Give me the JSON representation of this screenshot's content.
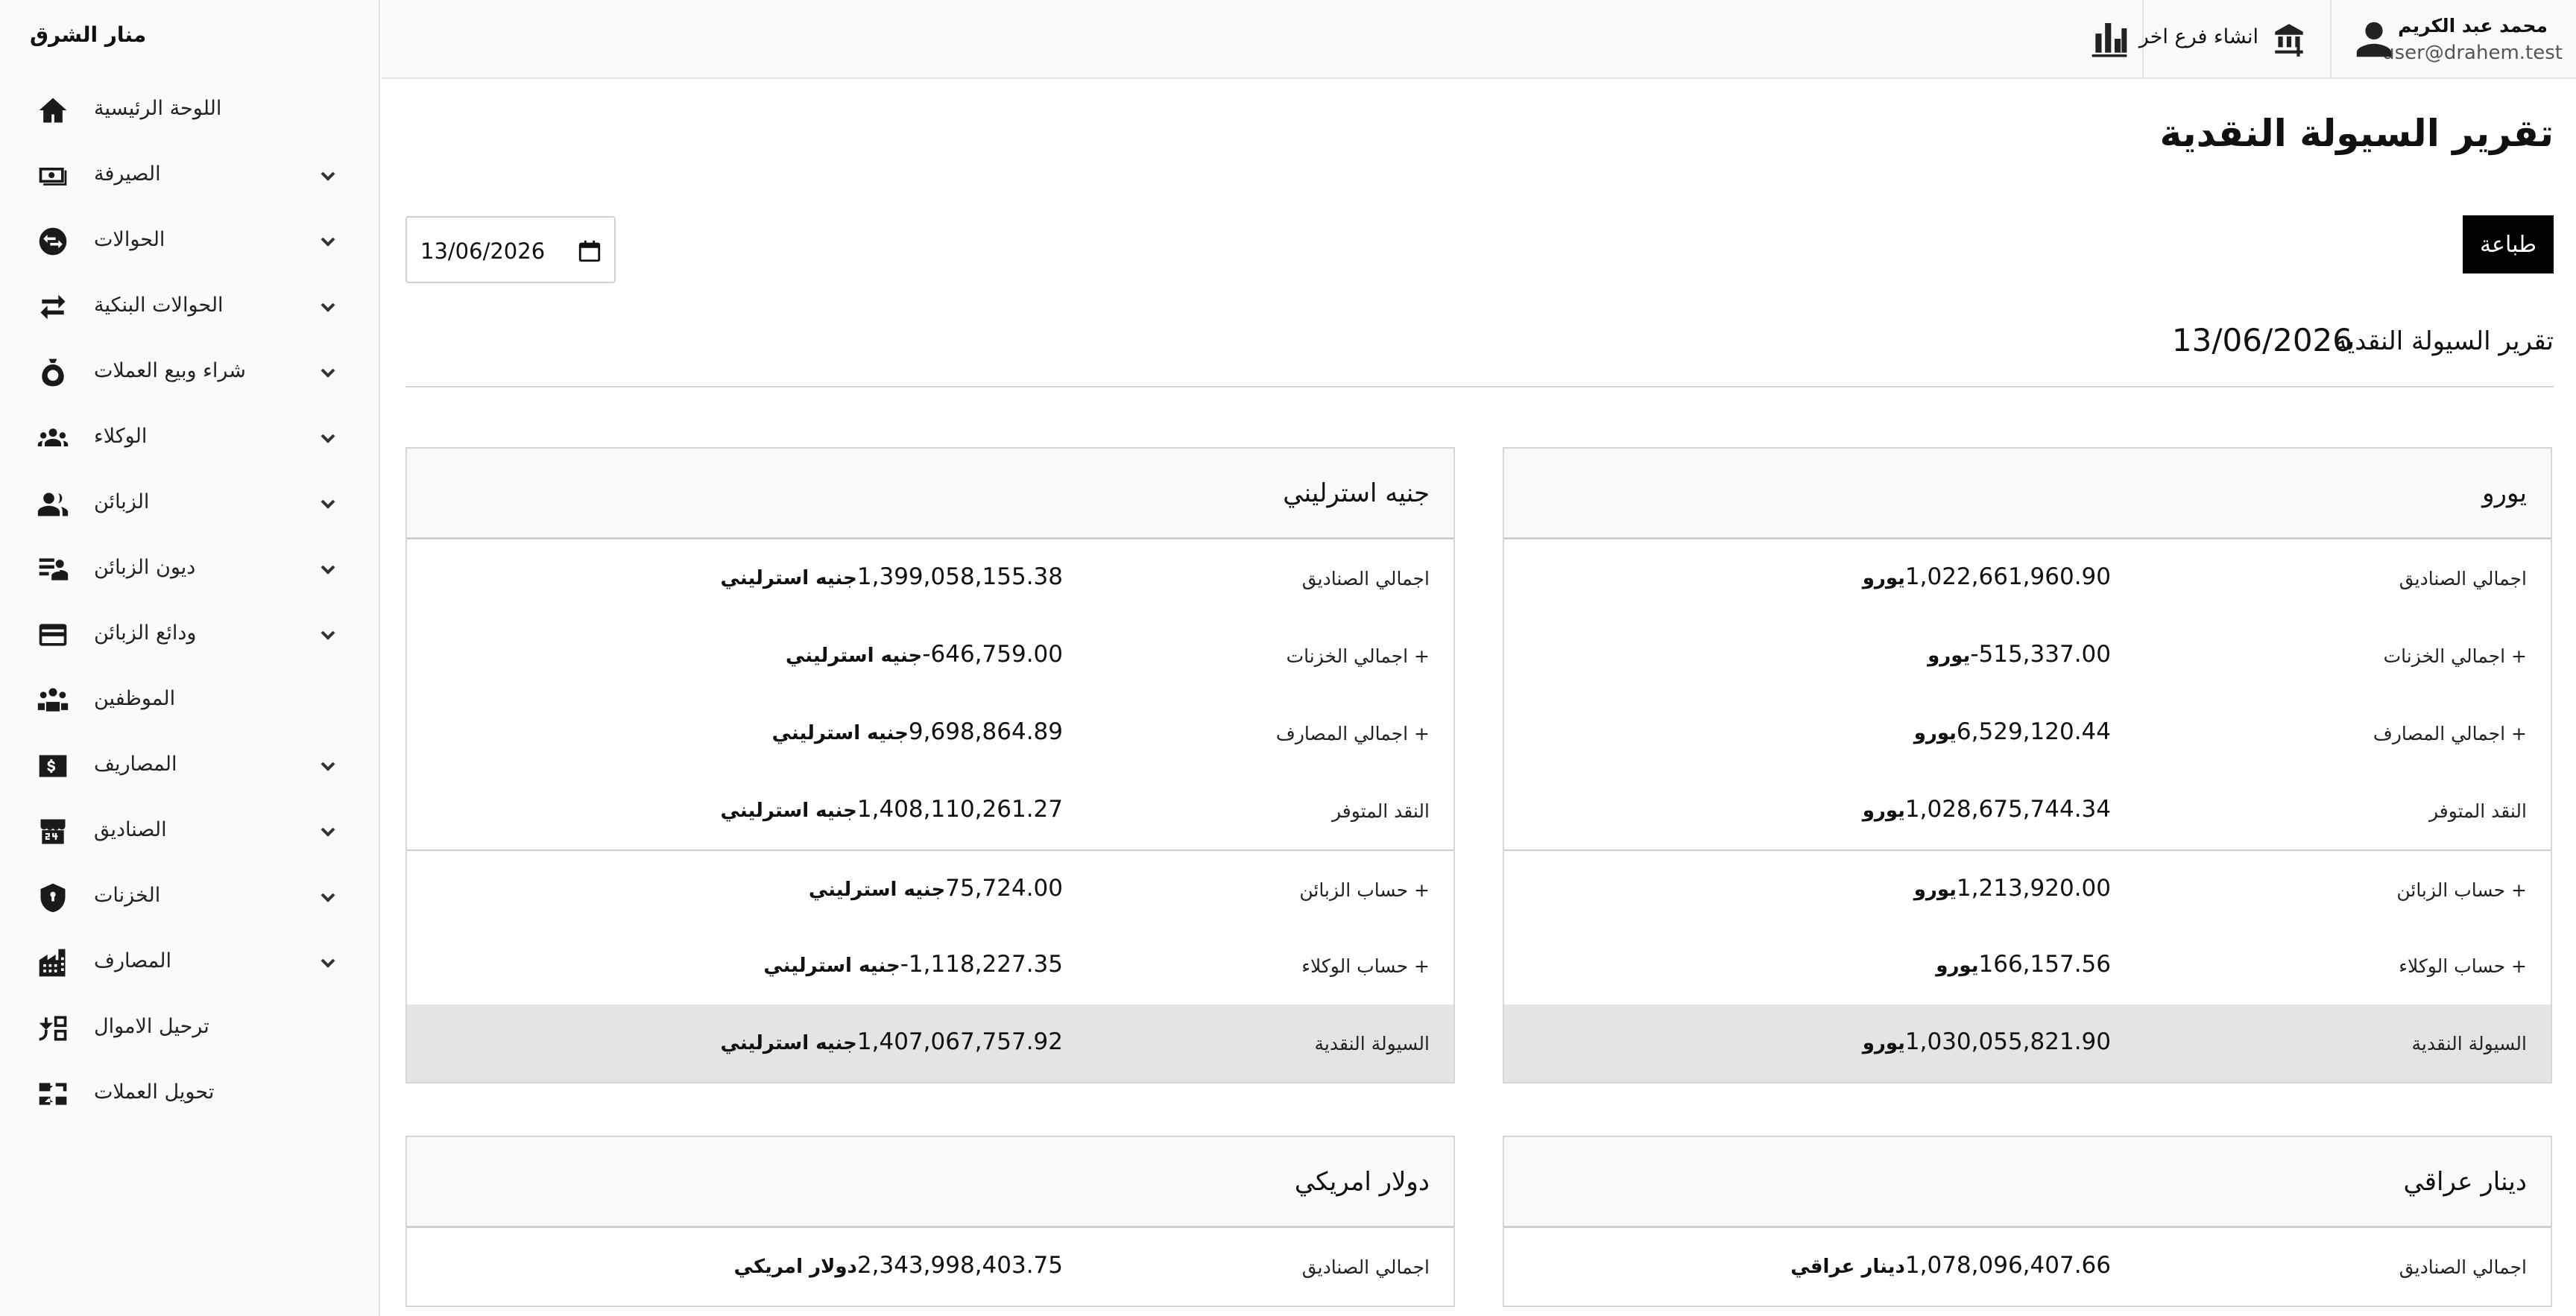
{
  "brand": "منار الشرق",
  "sidebar": {
    "items": [
      {
        "label": "اللوحة الرئيسية",
        "icon": "home-icon",
        "has_children": false
      },
      {
        "label": "الصيرفة",
        "icon": "cash-stack-icon",
        "has_children": true
      },
      {
        "label": "الحوالات",
        "icon": "currency-exchange-icon",
        "has_children": true
      },
      {
        "label": "الحوالات البنكية",
        "icon": "swap-arrows-icon",
        "has_children": true
      },
      {
        "label": "شراء وبيع العملات",
        "icon": "money-bag-icon",
        "has_children": true
      },
      {
        "label": "الوكلاء",
        "icon": "group-icon",
        "has_children": true
      },
      {
        "label": "الزبائن",
        "icon": "people-icon",
        "has_children": true
      },
      {
        "label": "ديون الزبائن",
        "icon": "person-list-icon",
        "has_children": true
      },
      {
        "label": "ودائع الزبائن",
        "icon": "wallet-icon",
        "has_children": true
      },
      {
        "label": "الموظفين",
        "icon": "team-icon",
        "has_children": false
      },
      {
        "label": "المصاريف",
        "icon": "dollar-note-icon",
        "has_children": true
      },
      {
        "label": "الصناديق",
        "icon": "store-24-icon",
        "has_children": true
      },
      {
        "label": "الخزنات",
        "icon": "shield-icon",
        "has_children": true
      },
      {
        "label": "المصارف",
        "icon": "bank-building-icon",
        "has_children": true
      },
      {
        "label": "ترحيل الاموال",
        "icon": "transfer-icon",
        "has_children": false
      },
      {
        "label": "تحويل العملات",
        "icon": "exchange-arrows-icon",
        "has_children": false
      }
    ]
  },
  "topbar": {
    "user_name": "محمد عبد الكريم",
    "user_email": "user@drahem.test",
    "branch_label": "انشاء فرع اخر",
    "chart_icon": "bar-chart-icon"
  },
  "main": {
    "title": "تقرير السيولة النقدية",
    "print_label": "طباعة",
    "date_value": "13/06/2026",
    "report_label": "تقرير السيولة النقدية",
    "report_date": "13/06/2026"
  },
  "cards": [
    {
      "title": "يورو",
      "currency": "يورو",
      "rows": [
        {
          "label": "اجمالي الصناديق",
          "value": "1,022,661,960.90"
        },
        {
          "label": "+ اجمالي الخزنات",
          "value": "-515,337.00"
        },
        {
          "label": "+ اجمالي المصارف",
          "value": "6,529,120.44"
        },
        {
          "label": "النقد المتوفر",
          "value": "1,028,675,744.34"
        },
        {
          "label": "+ حساب الزبائن",
          "value": "1,213,920.00"
        },
        {
          "label": "+ حساب الوكلاء",
          "value": "166,157.56"
        },
        {
          "label": "السيولة النقدية",
          "value": "1,030,055,821.90"
        }
      ]
    },
    {
      "title": "جنيه استرليني",
      "currency": "جنيه استرليني",
      "rows": [
        {
          "label": "اجمالي الصناديق",
          "value": "1,399,058,155.38"
        },
        {
          "label": "+ اجمالي الخزنات",
          "value": "-646,759.00"
        },
        {
          "label": "+ اجمالي المصارف",
          "value": "9,698,864.89"
        },
        {
          "label": "النقد المتوفر",
          "value": "1,408,110,261.27"
        },
        {
          "label": "+ حساب الزبائن",
          "value": "75,724.00"
        },
        {
          "label": "+ حساب الوكلاء",
          "value": "-1,118,227.35"
        },
        {
          "label": "السيولة النقدية",
          "value": "1,407,067,757.92"
        }
      ]
    },
    {
      "title": "دينار عراقي",
      "currency": "دينار عراقي",
      "rows": [
        {
          "label": "اجمالي الصناديق",
          "value": "1,078,096,407.66"
        }
      ]
    },
    {
      "title": "دولار امريكي",
      "currency": "دولار امريكي",
      "rows": [
        {
          "label": "اجمالي الصناديق",
          "value": "2,343,998,403.75"
        }
      ]
    }
  ]
}
